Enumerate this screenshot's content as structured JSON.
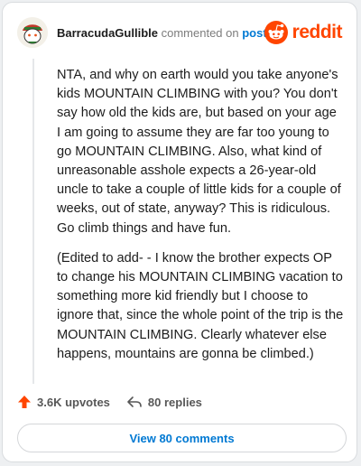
{
  "header": {
    "username": "BarracudaGullible",
    "action_text": "commented on",
    "post_link": "post",
    "brand": "reddit"
  },
  "comment": {
    "paragraphs": [
      "NTA, and why on earth would you take anyone's kids MOUNTAIN CLIMBING with you? You don't say how old the kids are, but based on your age I am going to assume they are far too young to go MOUNTAIN CLIMBING. Also, what kind of unreasonable asshole expects a 26-year-old uncle to take a couple of little kids for a couple of weeks, out of state, anyway? This is ridiculous. Go climb things and have fun.",
      "(Edited to add- - I know the brother expects OP to change his MOUNTAIN CLIMBING vacation to something more kid friendly but I choose to ignore that, since the whole point of the trip is the MOUNTAIN CLIMBING. Clearly whatever else happens, mountains are gonna be climbed.)"
    ]
  },
  "actions": {
    "upvotes": "3.6K upvotes",
    "replies": "80 replies"
  },
  "view_button": "View 80 comments",
  "icons": {
    "avatar": "snoo-avatar-icon",
    "brand_logo": "reddit-logo-icon",
    "upvote": "upvote-arrow-icon",
    "reply": "reply-arrow-icon"
  },
  "colors": {
    "brand": "#ff4500",
    "link": "#0079d3",
    "text": "#1c1c1c"
  }
}
